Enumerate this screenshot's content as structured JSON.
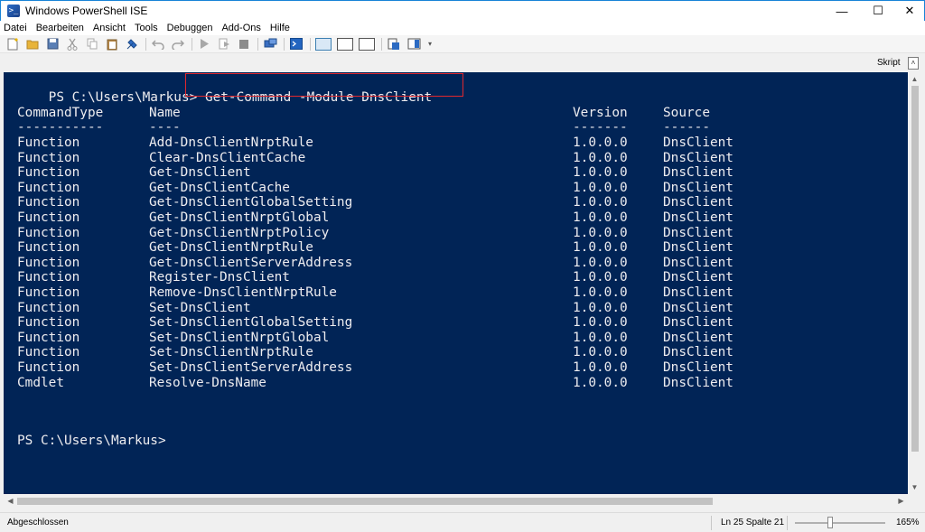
{
  "window": {
    "title": "Windows PowerShell ISE",
    "min": "—",
    "max": "☐",
    "close": "✕",
    "icon_glyph": ">_"
  },
  "menu": [
    "Datei",
    "Bearbeiten",
    "Ansicht",
    "Tools",
    "Debuggen",
    "Add-Ons",
    "Hilfe"
  ],
  "panel": {
    "skript_label": "Skript",
    "chevron": "˄"
  },
  "console": {
    "command_prompt": "PS C:\\Users\\Markus>",
    "command": " Get-Command -Module DnsClient",
    "headers": [
      "CommandType",
      "Name",
      "Version",
      "Source"
    ],
    "separators": [
      "-----------",
      "----",
      "-------",
      "------"
    ],
    "rows": [
      [
        "Function",
        "Add-DnsClientNrptRule",
        "1.0.0.0",
        "DnsClient"
      ],
      [
        "Function",
        "Clear-DnsClientCache",
        "1.0.0.0",
        "DnsClient"
      ],
      [
        "Function",
        "Get-DnsClient",
        "1.0.0.0",
        "DnsClient"
      ],
      [
        "Function",
        "Get-DnsClientCache",
        "1.0.0.0",
        "DnsClient"
      ],
      [
        "Function",
        "Get-DnsClientGlobalSetting",
        "1.0.0.0",
        "DnsClient"
      ],
      [
        "Function",
        "Get-DnsClientNrptGlobal",
        "1.0.0.0",
        "DnsClient"
      ],
      [
        "Function",
        "Get-DnsClientNrptPolicy",
        "1.0.0.0",
        "DnsClient"
      ],
      [
        "Function",
        "Get-DnsClientNrptRule",
        "1.0.0.0",
        "DnsClient"
      ],
      [
        "Function",
        "Get-DnsClientServerAddress",
        "1.0.0.0",
        "DnsClient"
      ],
      [
        "Function",
        "Register-DnsClient",
        "1.0.0.0",
        "DnsClient"
      ],
      [
        "Function",
        "Remove-DnsClientNrptRule",
        "1.0.0.0",
        "DnsClient"
      ],
      [
        "Function",
        "Set-DnsClient",
        "1.0.0.0",
        "DnsClient"
      ],
      [
        "Function",
        "Set-DnsClientGlobalSetting",
        "1.0.0.0",
        "DnsClient"
      ],
      [
        "Function",
        "Set-DnsClientNrptGlobal",
        "1.0.0.0",
        "DnsClient"
      ],
      [
        "Function",
        "Set-DnsClientNrptRule",
        "1.0.0.0",
        "DnsClient"
      ],
      [
        "Function",
        "Set-DnsClientServerAddress",
        "1.0.0.0",
        "DnsClient"
      ],
      [
        "Cmdlet",
        "Resolve-DnsName",
        "1.0.0.0",
        "DnsClient"
      ]
    ],
    "final_prompt": "PS C:\\Users\\Markus>",
    "highlight_color": "#e0282e",
    "background_color": "#012456"
  },
  "scroll": {
    "up": "▲",
    "down": "▼",
    "left": "◀",
    "right": "▶"
  },
  "status": {
    "text": "Abgeschlossen",
    "position": "Ln 25  Spalte 21",
    "zoom": "165%"
  }
}
